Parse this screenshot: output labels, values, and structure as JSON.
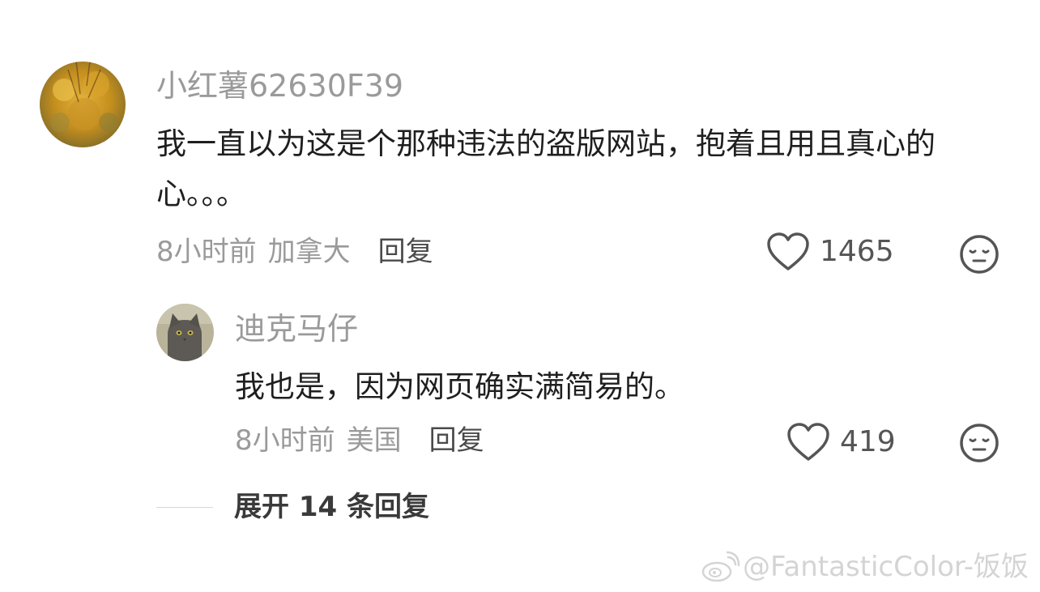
{
  "main_comment": {
    "username": "小红薯62630F39",
    "content": "我一直以为这是个那种违法的盗版网站，抱着且用且真心的心。。。",
    "time": "8小时前",
    "location": "加拿大",
    "reply_label": "回复",
    "like_count": "1465"
  },
  "reply_comment": {
    "username": "迪克马仔",
    "content": "我也是，因为网页确实满简易的。",
    "time": "8小时前",
    "location": "美国",
    "reply_label": "回复",
    "like_count": "419"
  },
  "expand_replies": {
    "label": "展开 14 条回复"
  },
  "watermark": {
    "text": "@FantasticColor-饭饭"
  },
  "icons": {
    "like": "heart-outline-icon",
    "dislike": "neutral-face-icon",
    "watermark": "weibo-logo-icon"
  },
  "colors": {
    "username": "#9a9a9a",
    "meta": "#9a9a9a",
    "reply_button": "#4a4a4a",
    "content": "#1f1f1f",
    "watermark": "#d4d4d4"
  }
}
